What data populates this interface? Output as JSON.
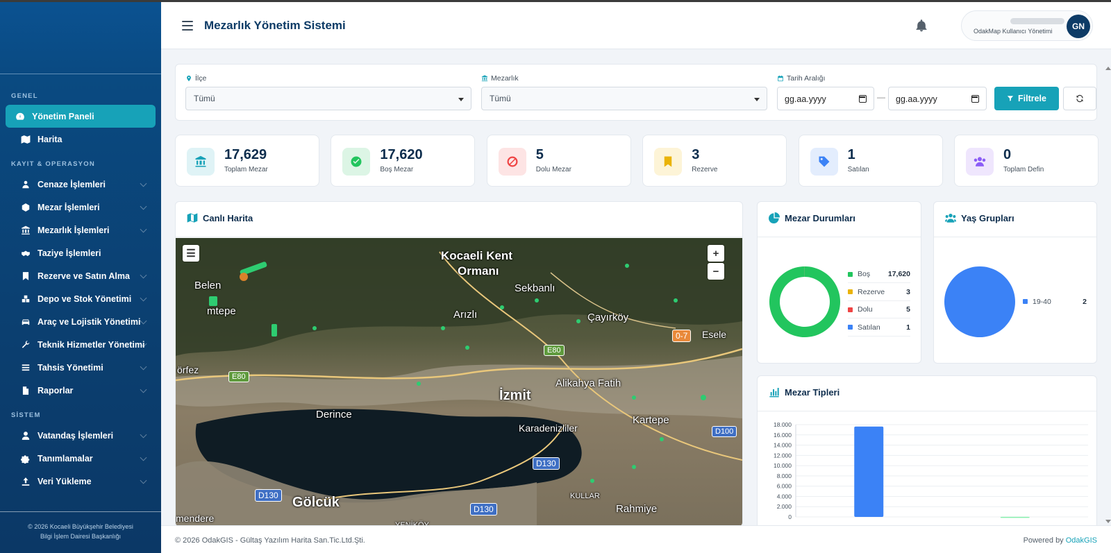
{
  "app": {
    "title": "Mezarlık Yönetim Sistemi"
  },
  "user": {
    "subtitle": "OdakMap Kullanıcı Yönetimi",
    "initials": "GN"
  },
  "sidebar": {
    "sections": [
      {
        "title": "GENEL"
      },
      {
        "title": "KAYIT & OPERASYON"
      },
      {
        "title": "SİSTEM"
      }
    ],
    "items": [
      {
        "label": "Yönetim Paneli",
        "icon": "dashboard-icon",
        "active": true
      },
      {
        "label": "Harita",
        "icon": "map-icon"
      },
      {
        "label": "Cenaze İşlemleri",
        "icon": "users-icon"
      },
      {
        "label": "Mezar İşlemleri",
        "icon": "box-icon"
      },
      {
        "label": "Mezarlık İşlemleri",
        "icon": "landmark-icon"
      },
      {
        "label": "Taziye İşlemleri",
        "icon": "handshake-icon"
      },
      {
        "label": "Rezerve ve Satın Alma",
        "icon": "bookmark-icon"
      },
      {
        "label": "Depo ve Stok Yönetimi",
        "icon": "boxes-icon"
      },
      {
        "label": "Araç ve Lojistik Yönetimi",
        "icon": "car-icon"
      },
      {
        "label": "Teknik Hizmetler Yönetimi",
        "icon": "wrench-icon"
      },
      {
        "label": "Tahsis Yönetimi",
        "icon": "list-icon"
      },
      {
        "label": "Raporlar",
        "icon": "file-icon"
      },
      {
        "label": "Vatandaş İşlemleri",
        "icon": "user-icon"
      },
      {
        "label": "Tanımlamalar",
        "icon": "cogs-icon"
      },
      {
        "label": "Veri Yükleme",
        "icon": "upload-icon"
      }
    ],
    "footer_line1": "© 2026 Kocaeli Büyükşehir Belediyesi",
    "footer_line2": "Bilgi İşlem Dairesi Başkanlığı"
  },
  "filters": {
    "ilce_label": "İlçe",
    "ilce_value": "Tümü",
    "mezarlik_label": "Mezarlık",
    "mezarlik_value": "Tümü",
    "tarih_label": "Tarih Aralığı",
    "date_start": "gg.aa.yyyy",
    "date_end": "gg.aa.yyyy",
    "filter_button": "Filtrele"
  },
  "stats": [
    {
      "value": "17,629",
      "label": "Toplam Mezar",
      "color": "#17a2b8"
    },
    {
      "value": "17,620",
      "label": "Boş Mezar",
      "color": "#22c55e"
    },
    {
      "value": "5",
      "label": "Dolu Mezar",
      "color": "#ef4444"
    },
    {
      "value": "3",
      "label": "Rezerve",
      "color": "#eab308"
    },
    {
      "value": "1",
      "label": "Satılan",
      "color": "#3b82f6"
    },
    {
      "value": "0",
      "label": "Toplam Defin",
      "color": "#8b5cf6"
    }
  ],
  "map_panel": {
    "title": "Canlı Harita",
    "places": [
      "Kocaeli Kent",
      "Ormanı",
      "Belen",
      "mtepe",
      "Sekbanlı",
      "Arızlı",
      "Çayırköy",
      "Esele",
      "0-7",
      "E80",
      "E80",
      "örfez",
      "İzmit",
      "Alikahya Fatih",
      "Derince",
      "Kartepe",
      "Karadenizliler",
      "D100",
      "D130",
      "D130",
      "D130",
      "Gölcük",
      "KULLAR",
      "Rahmiye",
      "mendere",
      "YENİKÖY"
    ]
  },
  "mezar_durumlari": {
    "title": "Mezar Durumları",
    "items": [
      {
        "label": "Boş",
        "value": "17,620",
        "color": "#22c55e"
      },
      {
        "label": "Rezerve",
        "value": "3",
        "color": "#eab308"
      },
      {
        "label": "Dolu",
        "value": "5",
        "color": "#ef4444"
      },
      {
        "label": "Satılan",
        "value": "1",
        "color": "#3b82f6"
      }
    ]
  },
  "yas_gruplari": {
    "title": "Yaş Grupları",
    "items": [
      {
        "label": "19-40",
        "value": "2",
        "color": "#3b82f6"
      }
    ]
  },
  "chart_data": [
    {
      "type": "pie",
      "categories": [
        "Boş",
        "Rezerve",
        "Dolu",
        "Satılan"
      ],
      "values": [
        17620,
        3,
        5,
        1
      ],
      "colors": [
        "#22c55e",
        "#eab308",
        "#ef4444",
        "#3b82f6"
      ],
      "legend": "right"
    },
    {
      "type": "pie",
      "categories": [
        "19-40"
      ],
      "values": [
        2
      ],
      "colors": [
        "#3b82f6"
      ],
      "legend": "right"
    },
    {
      "type": "bar",
      "title": "Mezar Tipleri",
      "categories": [
        "",
        ""
      ],
      "values": [
        17620,
        9
      ],
      "colors": [
        "#3b82f6",
        "#86efac"
      ],
      "ylim": [
        0,
        18000
      ],
      "yticks": [
        "18.000",
        "16.000",
        "14.000",
        "12.000",
        "10.000",
        "8.000",
        "6.000",
        "4.000",
        "2.000",
        "0"
      ],
      "grid": true
    }
  ],
  "footer": {
    "left": "© 2026 OdakGIS - Gültaş Yazılım Harita San.Tic.Ltd.Şti.",
    "powered": "Powered by",
    "brand": "OdakGIS"
  }
}
